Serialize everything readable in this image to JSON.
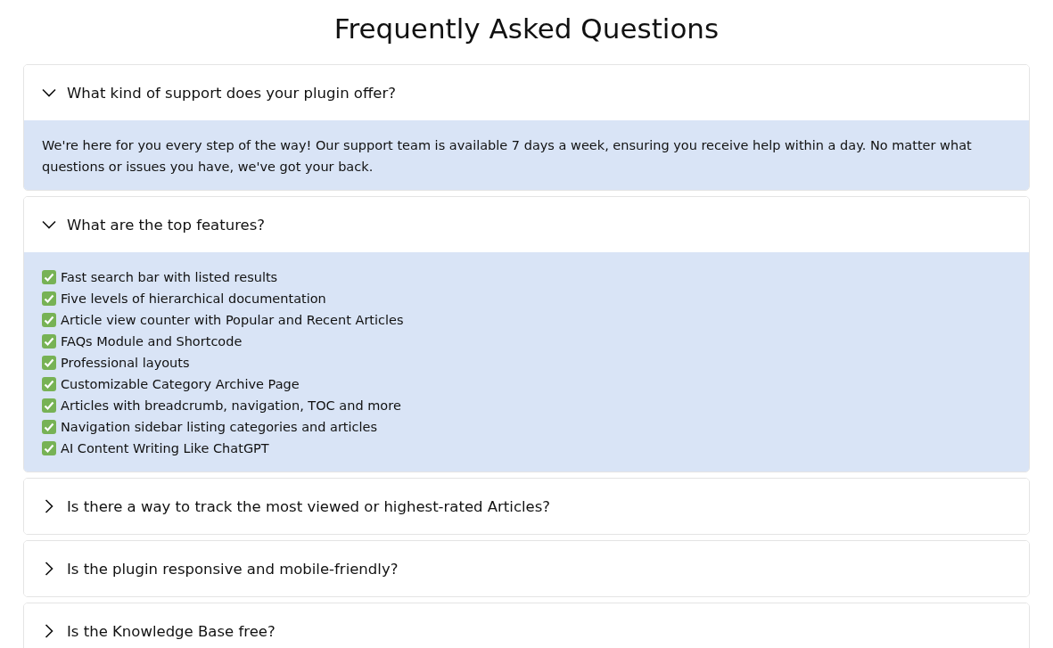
{
  "title": "Frequently Asked Questions",
  "faqs": [
    {
      "question": "What kind of support does your plugin offer?",
      "expanded": true,
      "answer": {
        "kind": "paragraph",
        "text": "We're here for you every step of the way! Our support team is available 7 days a week, ensuring you receive help within a day. No matter what questions or issues you have, we've got your back."
      }
    },
    {
      "question": "What are the top features?",
      "expanded": true,
      "answer": {
        "kind": "checklist",
        "items": [
          "Fast search bar with listed results",
          "Five levels of hierarchical documentation",
          "Article view counter with Popular and Recent Articles",
          "FAQs Module and Shortcode",
          "Professional layouts",
          "Customizable Category Archive Page",
          "Articles with breadcrumb, navigation, TOC and more",
          "Navigation sidebar listing categories and articles",
          "AI Content Writing Like ChatGPT"
        ]
      }
    },
    {
      "question": "Is there a way to track the most viewed or highest-rated Articles?",
      "expanded": false
    },
    {
      "question": "Is the plugin responsive and mobile-friendly?",
      "expanded": false
    },
    {
      "question": "Is the Knowledge Base free?",
      "expanded": false
    }
  ]
}
